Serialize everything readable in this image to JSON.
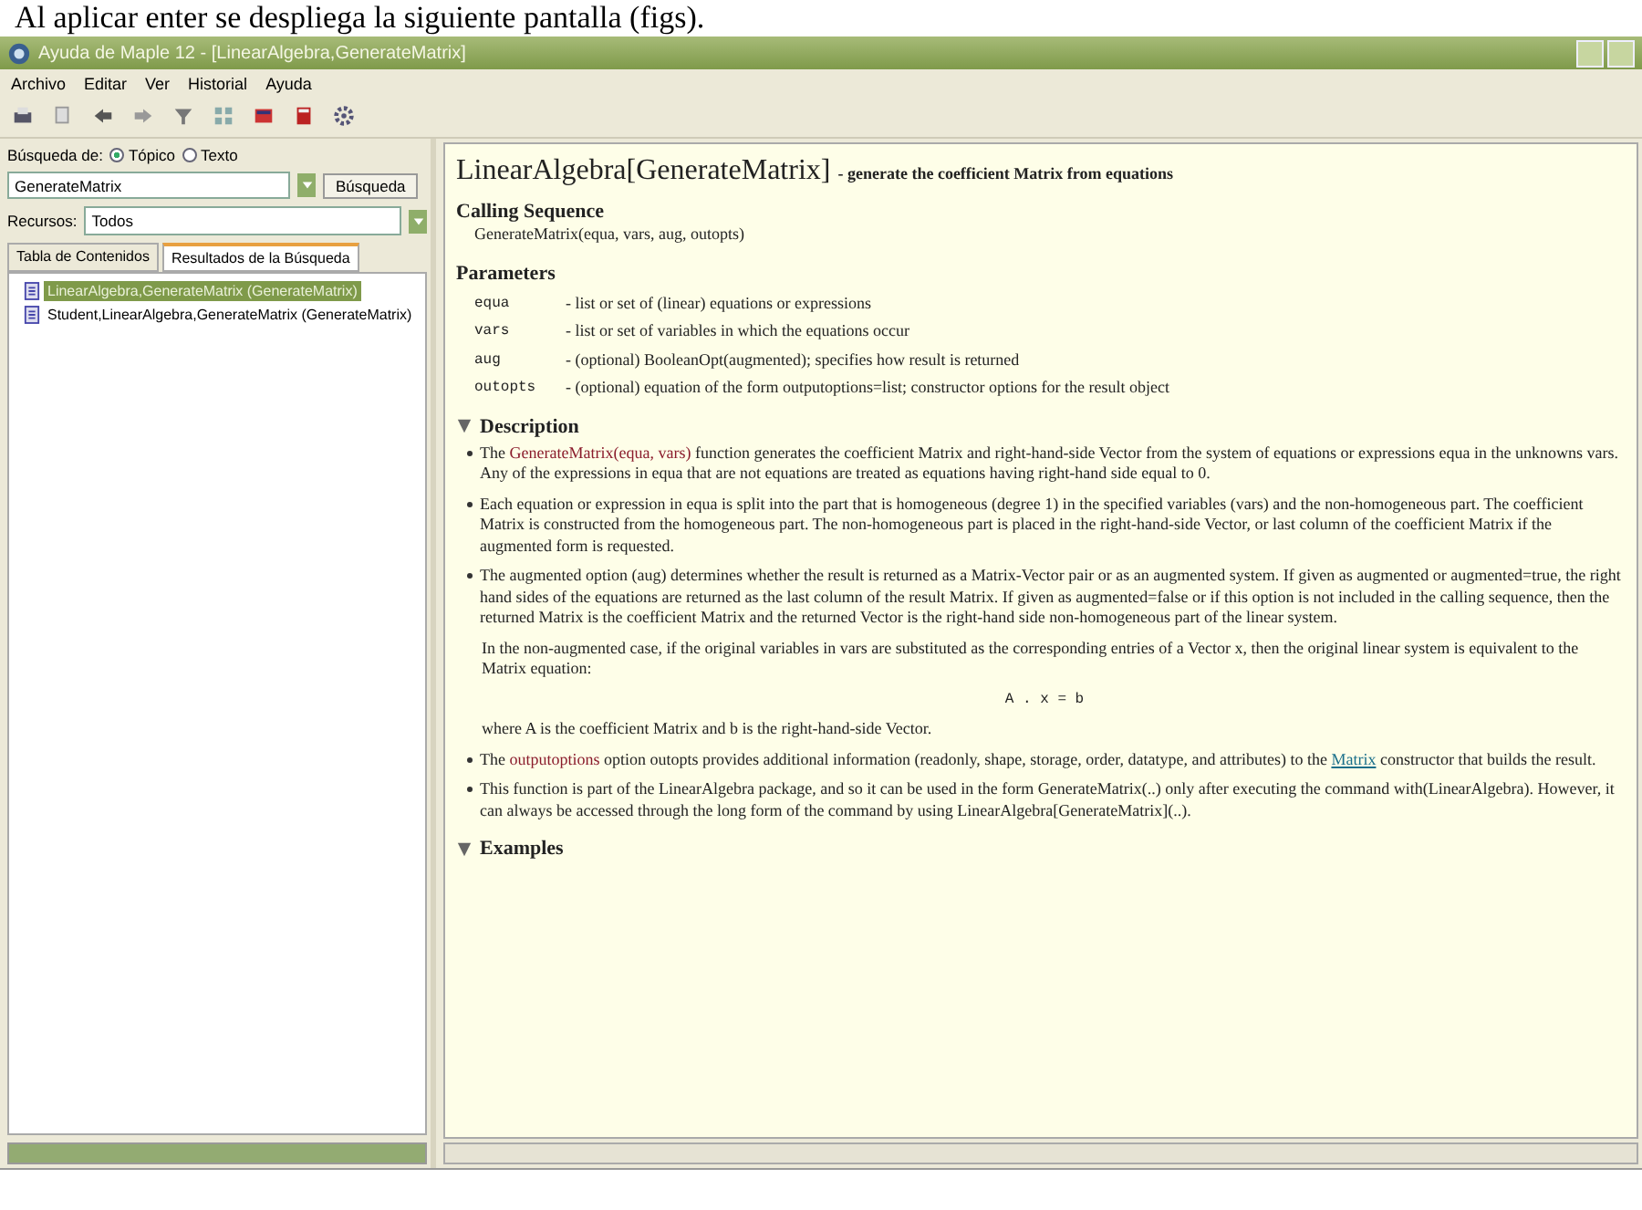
{
  "caption": "Al aplicar enter se despliega la siguiente pantalla (figs).",
  "window": {
    "title": "Ayuda de Maple 12 - [LinearAlgebra,GenerateMatrix]"
  },
  "menu": [
    "Archivo",
    "Editar",
    "Ver",
    "Historial",
    "Ayuda"
  ],
  "search": {
    "label": "Búsqueda de:",
    "options": [
      {
        "label": "Tópico",
        "selected": true
      },
      {
        "label": "Texto",
        "selected": false
      }
    ],
    "value": "GenerateMatrix",
    "button": "Búsqueda",
    "resources_label": "Recursos:",
    "resources_value": "Todos"
  },
  "tabs": [
    {
      "label": "Tabla de Contenidos",
      "selected": false
    },
    {
      "label": "Resultados de la Búsqueda",
      "selected": true
    }
  ],
  "results": [
    {
      "label": "LinearAlgebra,GenerateMatrix (GenerateMatrix)",
      "selected": true
    },
    {
      "label": "Student,LinearAlgebra,GenerateMatrix (GenerateMatrix)",
      "selected": false
    }
  ],
  "page": {
    "title": "LinearAlgebra[GenerateMatrix]",
    "subtitle": "- generate the coefficient Matrix from equations",
    "calling_heading": "Calling Sequence",
    "calling": "GenerateMatrix(equa, vars, aug, outopts)",
    "parameters_heading": "Parameters",
    "parameters": [
      {
        "name": "equa",
        "desc": "- list or set of (linear) equations or expressions"
      },
      {
        "name": "vars",
        "desc": "- list or set of variables in which the equations occur"
      },
      {
        "name": "aug",
        "desc": "- (optional) BooleanOpt(augmented); specifies how result is returned"
      },
      {
        "name": "outopts",
        "desc": "- (optional) equation of the form outputoptions=list; constructor options for the result object"
      }
    ],
    "sections": [
      {
        "heading": "Description",
        "expanded": true,
        "items": [
          {
            "kind": "bullet",
            "segments": [
              {
                "kind": "text",
                "text": "The "
              },
              {
                "kind": "code",
                "text": "GenerateMatrix(equa, vars)"
              },
              {
                "kind": "text",
                "text": " function generates the coefficient Matrix and right-hand-side Vector from the system of equations or expressions equa in the unknowns vars. Any of the expressions in equa that are not equations are treated as equations having right-hand side equal to 0."
              }
            ]
          },
          {
            "kind": "bullet",
            "segments": [
              {
                "kind": "text",
                "text": "Each equation or expression in equa is split into the part that is homogeneous (degree 1) in the specified variables (vars) and the non-homogeneous part. The coefficient Matrix is constructed from the homogeneous part. The non-homogeneous part is placed in the right-hand-side Vector, or last column of the coefficient Matrix if the augmented form is requested."
              }
            ]
          },
          {
            "kind": "bullet",
            "segments": [
              {
                "kind": "text",
                "text": "The augmented option (aug) determines whether the result is returned as a Matrix-Vector pair or as an augmented system. If given as augmented or augmented=true, the right hand sides of the equations are returned as the last column of the result Matrix. If given as augmented=false or if this option is not included in the calling sequence, then the returned Matrix is the coefficient Matrix and the returned Vector is the right-hand side non-homogeneous part of the linear system."
              }
            ]
          },
          {
            "kind": "note",
            "segments": [
              {
                "kind": "text",
                "text": "In the non-augmented case, if the original variables in vars are substituted as the corresponding entries of a Vector x, then the original linear system is equivalent to the Matrix equation:"
              }
            ]
          },
          {
            "kind": "equation",
            "segments": [
              {
                "kind": "text",
                "text": "A . x = b"
              }
            ]
          },
          {
            "kind": "note",
            "segments": [
              {
                "kind": "text",
                "text": "where A is the coefficient Matrix and b is the right-hand-side Vector."
              }
            ]
          },
          {
            "kind": "bullet",
            "segments": [
              {
                "kind": "text",
                "text": "The "
              },
              {
                "kind": "code",
                "text": "outputoptions"
              },
              {
                "kind": "text",
                "text": " option outopts provides additional information (readonly, shape, storage, order, datatype, and attributes) to the "
              },
              {
                "kind": "link",
                "text": "Matrix"
              },
              {
                "kind": "text",
                "text": " constructor that builds the result."
              }
            ]
          },
          {
            "kind": "bullet",
            "segments": [
              {
                "kind": "text",
                "text": "This function is part of the LinearAlgebra package, and so it can be used in the form GenerateMatrix(..) only after executing the command with(LinearAlgebra). However, it can always be accessed through the long form of the command by using LinearAlgebra[GenerateMatrix](..)."
              }
            ]
          }
        ]
      },
      {
        "heading": "Examples",
        "expanded": true
      }
    ]
  }
}
